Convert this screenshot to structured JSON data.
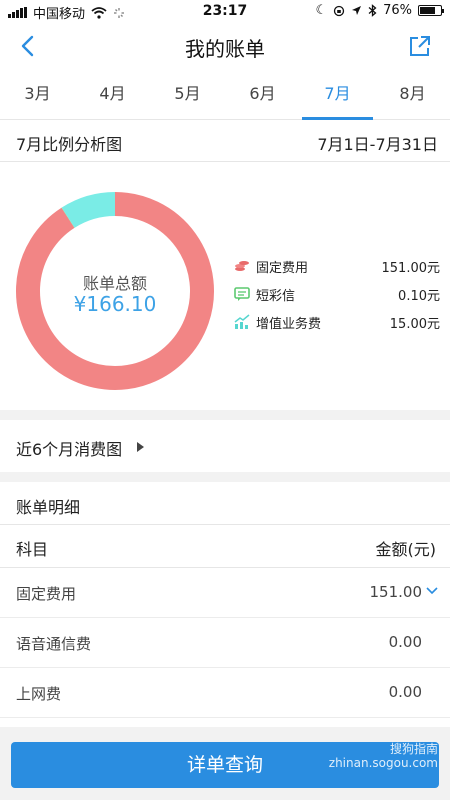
{
  "status_bar": {
    "carrier": "中国移动",
    "time": "23:17",
    "battery": "76%",
    "battery_level": 0.76
  },
  "nav": {
    "title": "我的账单",
    "back_icon": "chevron-left-icon",
    "share_icon": "share-out-icon"
  },
  "months": [
    {
      "label": "3月",
      "active": false
    },
    {
      "label": "4月",
      "active": false
    },
    {
      "label": "5月",
      "active": false
    },
    {
      "label": "6月",
      "active": false
    },
    {
      "label": "7月",
      "active": true
    },
    {
      "label": "8月",
      "active": false
    }
  ],
  "analysis": {
    "title": "7月比例分析图",
    "range": "7月1日-7月31日",
    "total_label": "账单总额",
    "total_value": "¥166.10"
  },
  "legend": [
    {
      "name": "固定费用",
      "value": "151.00元"
    },
    {
      "name": "短彩信",
      "value": "0.10元"
    },
    {
      "name": "增值业务费",
      "value": "15.00元"
    }
  ],
  "chart_data": {
    "type": "pie",
    "categories": [
      "固定费用",
      "短彩信",
      "增值业务费"
    ],
    "values": [
      151.0,
      0.1,
      15.0
    ],
    "colors": [
      "#f28585",
      "#7fd98f",
      "#7aece6"
    ]
  },
  "trend": {
    "label": "近6个月消费图"
  },
  "detail": {
    "title": "账单明细",
    "col_item": "科目",
    "col_amount": "金额(元)",
    "rows": [
      {
        "name": "固定费用",
        "amount": "151.00"
      },
      {
        "name": "语音通信费",
        "amount": "0.00"
      },
      {
        "name": "上网费",
        "amount": "0.00"
      }
    ]
  },
  "button": {
    "label": "详单查询"
  },
  "watermark": {
    "line1": "搜狗指南",
    "line2": "zhinan.sogou.com"
  },
  "colors": {
    "accent": "#2a8de0"
  }
}
